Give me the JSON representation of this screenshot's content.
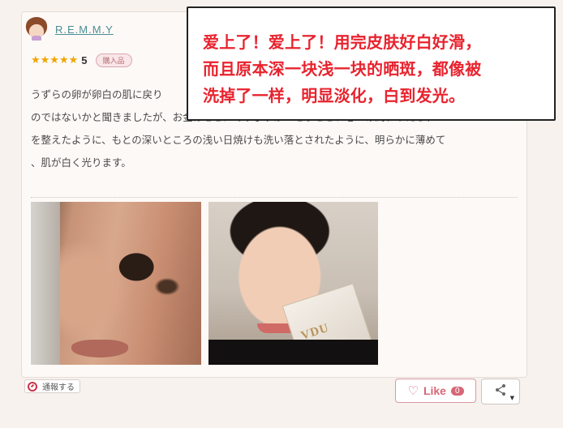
{
  "review": {
    "username": "R.E.M.M.Y",
    "stars": "★★★★★",
    "score": "5",
    "badge": "購入品",
    "text_lines": [
      "うずらの卵が卵白の肌に戻り",
      "のではないかと聞きましたが、お金はどこにありますか？とうせこれをつけ終わったら、",
      "を整えたように、もとの深いところの浅い日焼けも洗い落とされたように、明らかに薄めて",
      "、肌が白く光ります。"
    ]
  },
  "photos": {
    "after_pack_text": "VDU"
  },
  "actions": {
    "report_label": "通報する",
    "like_label": "Like",
    "like_count": "0"
  },
  "callout": {
    "lines": [
      "爱上了！爱上了！用完皮肤好白好滑，",
      "而且原本深一块浅一块的晒斑，都像被",
      "洗掉了一样，明显淡化，白到发光。"
    ],
    "text_color": "#e8232e"
  },
  "colors": {
    "username": "#4a8d95",
    "star": "#f0a500",
    "like_accent": "#d66777"
  },
  "icons": {
    "heart": "heart-icon",
    "share": "share-icon",
    "report": "report-icon",
    "avatar": "avatar"
  }
}
